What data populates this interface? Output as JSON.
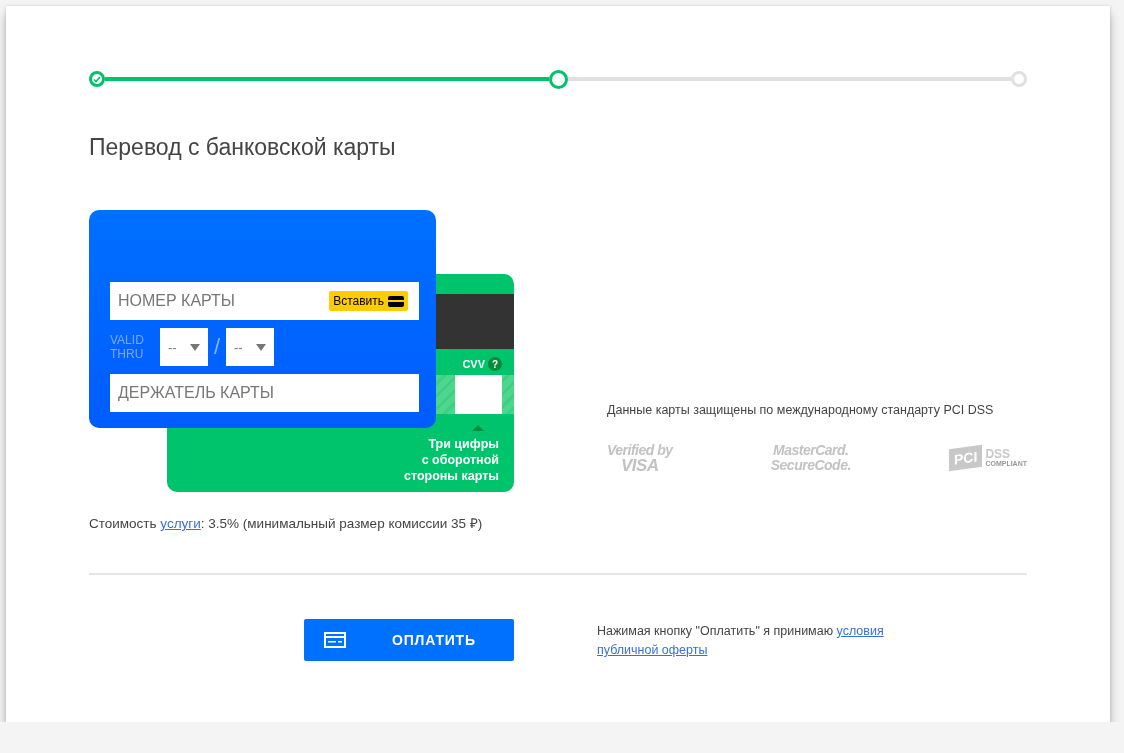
{
  "steps": [
    {
      "completed": true,
      "selected": false
    },
    {
      "completed": false,
      "selected": true
    },
    {
      "completed": false,
      "selected": false
    }
  ],
  "title": "Перевод с банковской карты",
  "card_front": {
    "number_placeholder": "НОМЕР КАРТЫ",
    "paste_button": "Вставить",
    "valid_thru": [
      "VALID",
      "THRU"
    ],
    "month_placeholder": "--",
    "separator": "/",
    "year_placeholder": "--",
    "holder_placeholder": "ДЕРЖАТЕЛЬ КАРТЫ"
  },
  "card_back": {
    "cvv_label": "CVV",
    "help": "?",
    "hint": [
      "Три цифры",
      "с оборотной",
      "стороны карты"
    ]
  },
  "security": {
    "text": "Данные карты защищены по международному стандарту PCI DSS",
    "logos": [
      {
        "kind": "visa",
        "lines": [
          "Verified by",
          "VISA"
        ]
      },
      {
        "kind": "mastercard",
        "lines": [
          "MasterCard.",
          "SecureCode."
        ]
      },
      {
        "kind": "pci",
        "lines": [
          "PCI",
          "DSS",
          "COMPLIANT"
        ]
      }
    ]
  },
  "fee": {
    "before": "Стоимость ",
    "link": "услуги",
    "after": ": 3.5% (минимальный размер комиссии 35 ₽)"
  },
  "pay_button": "ОПЛАТИТЬ",
  "terms": {
    "text": "Нажимая кнопку \"Оплатить\" я принимаю ",
    "link": [
      "условия",
      "публичной оферты"
    ]
  }
}
